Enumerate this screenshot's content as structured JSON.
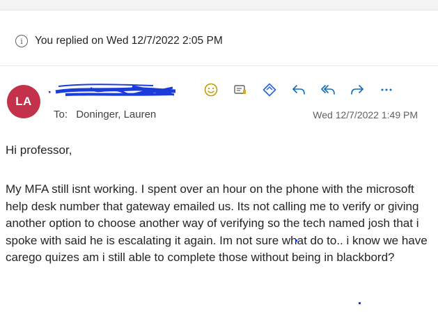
{
  "notice": {
    "icon": "info-icon",
    "text": "You replied on Wed 12/7/2022 2:05 PM"
  },
  "message": {
    "avatar_initials": "LA",
    "avatar_color": "#c4314b",
    "to_label": "To:",
    "to_recipient": "Doninger, Lauren",
    "timestamp": "Wed 12/7/2022 1:49 PM",
    "greeting": "Hi professor,",
    "body": "My MFA still isnt working. I spent over an hour on the phone with the microsoft help desk number that gateway emailed us. Its not calling me to verify or giving another option to choose another way of verifying so the tech named josh that i spoke with said he is escalating it again. Im not sure what do to.. i know we have carego quizes am i still able to complete those without being in blackbord?"
  },
  "actions": [
    {
      "icon": "smiley-icon",
      "color": "#c19c00"
    },
    {
      "icon": "immersive-reader-icon",
      "color": "#616161"
    },
    {
      "icon": "loop-icon",
      "color": "#2b66d9"
    },
    {
      "icon": "reply-icon",
      "color": "#0f6cbd"
    },
    {
      "icon": "reply-all-icon",
      "color": "#0f6cbd"
    },
    {
      "icon": "forward-icon",
      "color": "#0f6cbd"
    },
    {
      "icon": "more-icon",
      "color": "#0f6cbd"
    }
  ],
  "redaction_color": "#1a3cd8"
}
